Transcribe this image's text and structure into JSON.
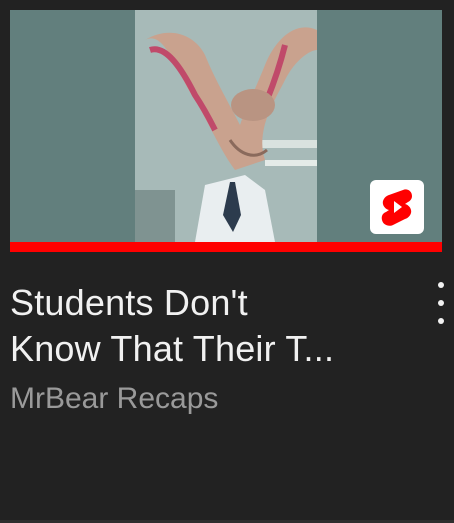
{
  "video": {
    "title": "Students Don't\nKnow That Their T...",
    "channel": "MrBear Recaps",
    "watched_fraction": 1.0,
    "badge_icon": "youtube-shorts-icon"
  },
  "colors": {
    "background": "#222222",
    "progress": "#ff0000",
    "title_text": "#f1f1f1",
    "channel_text": "#9a9a9a",
    "shorts_red": "#ff0000"
  },
  "menu": {
    "icon": "more-vertical-icon"
  }
}
